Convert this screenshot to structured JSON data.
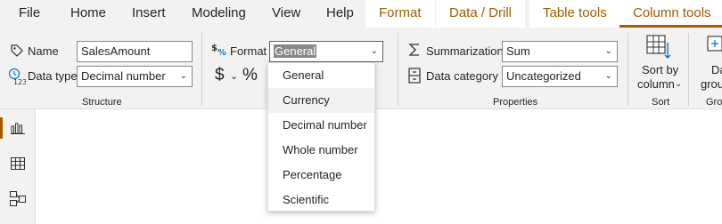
{
  "tabs": {
    "file": "File",
    "home": "Home",
    "insert": "Insert",
    "modeling": "Modeling",
    "view": "View",
    "help": "Help",
    "format": "Format",
    "data_drill": "Data / Drill",
    "table_tools": "Table tools",
    "column_tools": "Column tools"
  },
  "structure": {
    "name_label": "Name",
    "name_value": "SalesAmount",
    "datatype_label": "Data type",
    "datatype_value": "Decimal number",
    "group_title": "Structure"
  },
  "formatting": {
    "format_label": "Format",
    "format_value": "General",
    "currency_symbol": "$",
    "percent_symbol": "%",
    "options": [
      "General",
      "Currency",
      "Decimal number",
      "Whole number",
      "Percentage",
      "Scientific"
    ],
    "hovered_option": "Currency"
  },
  "properties": {
    "summarization_label": "Summarization",
    "summarization_value": "Sum",
    "datacategory_label": "Data category",
    "datacategory_value": "Uncategorized",
    "group_title": "Properties"
  },
  "sort": {
    "button_line1": "Sort by",
    "button_line2": "column",
    "group_title": "Sort"
  },
  "groups": {
    "button_line1": "Da",
    "button_line2": "grou",
    "group_title": "Gro"
  },
  "colors": {
    "accent": "#a15c00",
    "ribbon_bg": "#f3f2f1",
    "icon_blue": "#0078d4"
  },
  "rail": {
    "items": [
      "report-view",
      "data-view",
      "model-view"
    ],
    "active": "report-view"
  }
}
